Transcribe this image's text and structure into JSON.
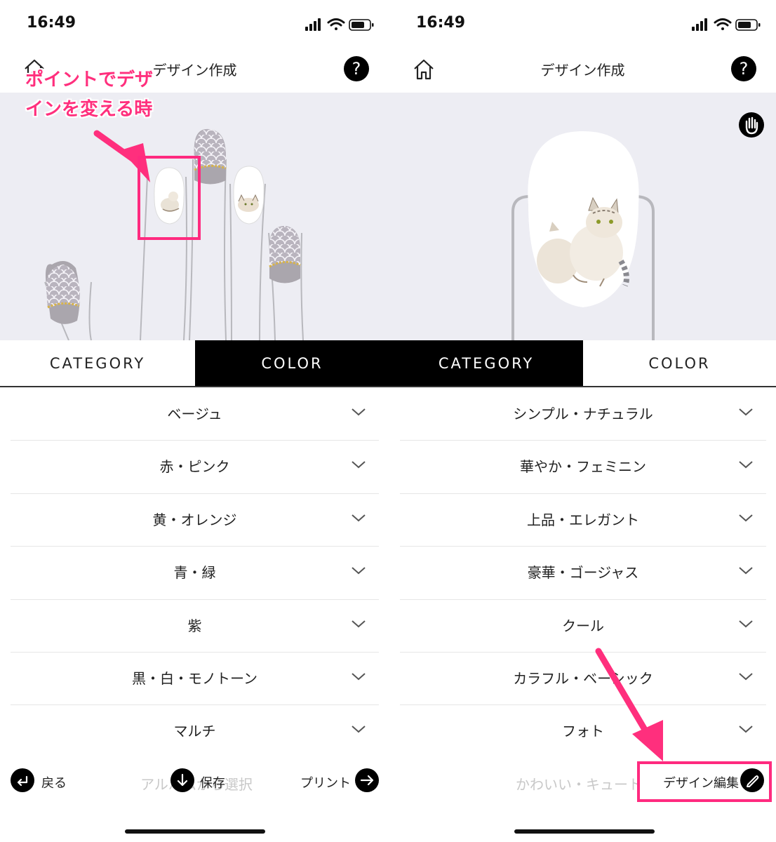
{
  "left_screen": {
    "status": {
      "time": "16:49"
    },
    "header": {
      "title": "デザイン作成",
      "help": "?"
    },
    "annotation": {
      "line1": "ポイントでデザ",
      "line2": "インを変える時"
    },
    "tabs": [
      {
        "label": "CATEGORY",
        "active": false
      },
      {
        "label": "COLOR",
        "active": true
      }
    ],
    "list": [
      "ベージュ",
      "赤・ピンク",
      "黄・オレンジ",
      "青・緑",
      "紫",
      "黒・白・モノトーン",
      "マルチ"
    ],
    "bottom": {
      "back_label": "戻る",
      "save_label": "保存",
      "print_label": "プリント",
      "faded_text": "アルバムから選択"
    }
  },
  "right_screen": {
    "status": {
      "time": "16:49"
    },
    "header": {
      "title": "デザイン作成",
      "help": "?"
    },
    "tabs": [
      {
        "label": "CATEGORY",
        "active": true
      },
      {
        "label": "COLOR",
        "active": false
      }
    ],
    "list": [
      "シンプル・ナチュラル",
      "華やか・フェミニン",
      "上品・エレガント",
      "豪華・ゴージャス",
      "クール",
      "カラフル・ベーシック",
      "フォト"
    ],
    "bottom": {
      "faded_text": "かわいい・キュート",
      "edit_label": "デザイン編集"
    }
  },
  "colors": {
    "accent": "#ff2f7d",
    "preview_bg": "#ededf3",
    "tab_active_bg": "#000000"
  }
}
